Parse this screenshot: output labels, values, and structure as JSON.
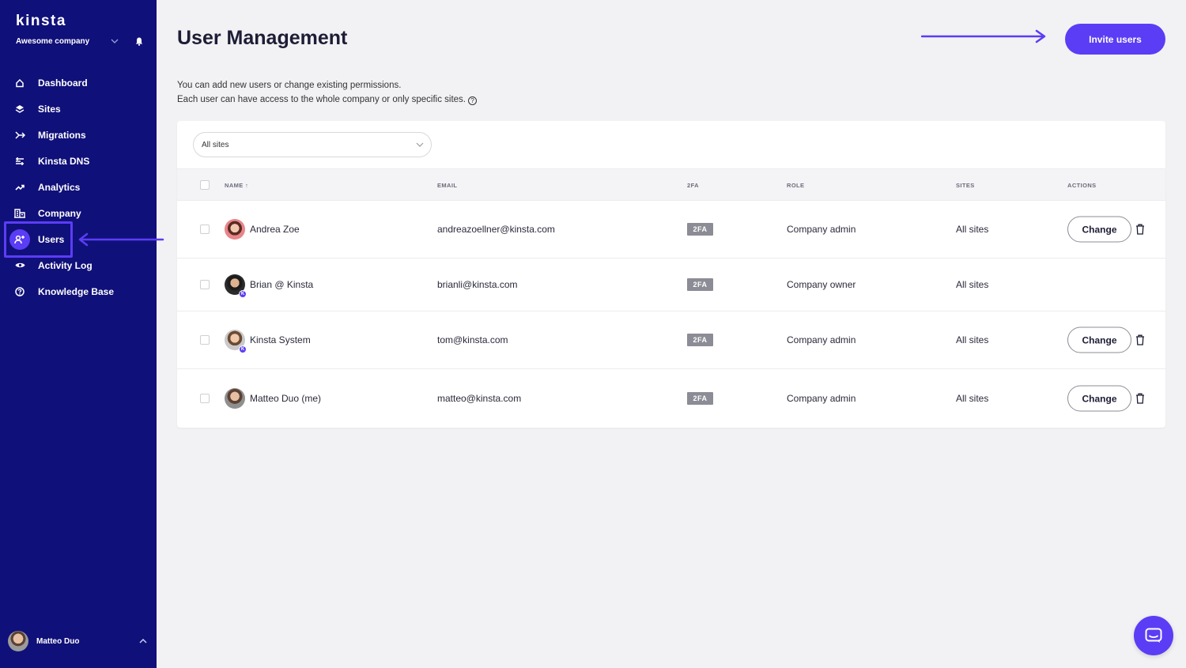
{
  "brand": {
    "logo": "kinsta",
    "accent": "#5b3df5",
    "sidebar_bg": "#10107a"
  },
  "sidebar": {
    "company": "Awesome company",
    "items": [
      {
        "label": "Dashboard",
        "icon": "home-icon"
      },
      {
        "label": "Sites",
        "icon": "layers-icon"
      },
      {
        "label": "Migrations",
        "icon": "migrate-icon"
      },
      {
        "label": "Kinsta DNS",
        "icon": "dns-icon"
      },
      {
        "label": "Analytics",
        "icon": "trend-icon"
      },
      {
        "label": "Company",
        "icon": "building-icon"
      },
      {
        "label": "Users",
        "icon": "add-user-icon",
        "active": true
      },
      {
        "label": "Activity Log",
        "icon": "eye-icon"
      },
      {
        "label": "Knowledge Base",
        "icon": "help-circle-icon"
      }
    ],
    "user": {
      "name": "Matteo Duo"
    }
  },
  "main": {
    "title": "User Management",
    "description_line1": "You can add new users or change existing permissions.",
    "description_line2": "Each user can have access to the whole company or only specific sites.",
    "invite_button": "Invite users",
    "filter": {
      "selected": "All sites"
    },
    "table": {
      "headers": {
        "name": "NAME ↑",
        "email": "EMAIL",
        "twofa": "2FA",
        "role": "ROLE",
        "sites": "SITES",
        "actions": "ACTIONS"
      },
      "rows": [
        {
          "name": "Andrea Zoe",
          "email": "andreazoellner@kinsta.com",
          "twofa": "2FA",
          "role": "Company admin",
          "sites": "All sites",
          "action": "Change"
        },
        {
          "name": "Brian @ Kinsta",
          "email": "brianli@kinsta.com",
          "twofa": "2FA",
          "role": "Company owner",
          "sites": "All sites",
          "action": ""
        },
        {
          "name": "Kinsta System",
          "email": "tom@kinsta.com",
          "twofa": "2FA",
          "role": "Company admin",
          "sites": "All sites",
          "action": "Change"
        },
        {
          "name": "Matteo Duo (me)",
          "email": "matteo@kinsta.com",
          "twofa": "2FA",
          "role": "Company admin",
          "sites": "All sites",
          "action": "Change"
        }
      ]
    }
  },
  "chat": {
    "icon": "chat-icon"
  },
  "badge_letter": "K"
}
